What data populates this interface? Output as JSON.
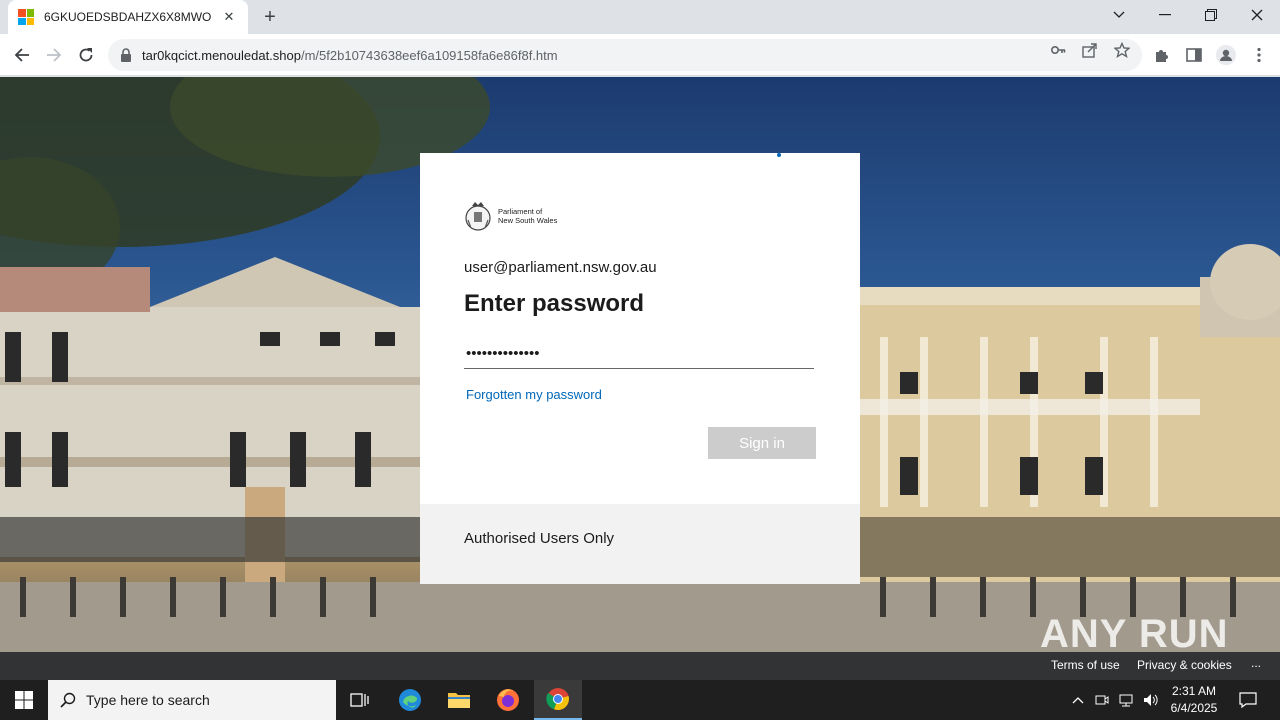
{
  "browser": {
    "tab": {
      "title": "6GKUOEDSBDAHZX6X8MWO",
      "close_icon": "close-icon"
    },
    "new_tab_icon": "plus-icon",
    "address": {
      "host": "tar0kqcict.menouledat.shop",
      "path": "/m/5f2b10743638eef6a109158fa6e86f8f.htm"
    },
    "window_controls": [
      "chevron-down-icon",
      "minimize-icon",
      "restore-icon",
      "close-icon"
    ]
  },
  "login": {
    "org_name_line1": "Parliament of",
    "org_name_line2": "New South Wales",
    "identity_email": "user@parliament.nsw.gov.au",
    "heading": "Enter password",
    "password_value": "••••••••••••••",
    "forgot_link": "Forgotten my password",
    "signin_button": "Sign in",
    "footer_text": "Authorised Users Only"
  },
  "page_footer": {
    "terms": "Terms of use",
    "privacy": "Privacy & cookies",
    "more": "..."
  },
  "watermark": "ANY RUN",
  "taskbar": {
    "search_placeholder": "Type here to search",
    "time": "2:31 AM",
    "date": "6/4/2025"
  }
}
